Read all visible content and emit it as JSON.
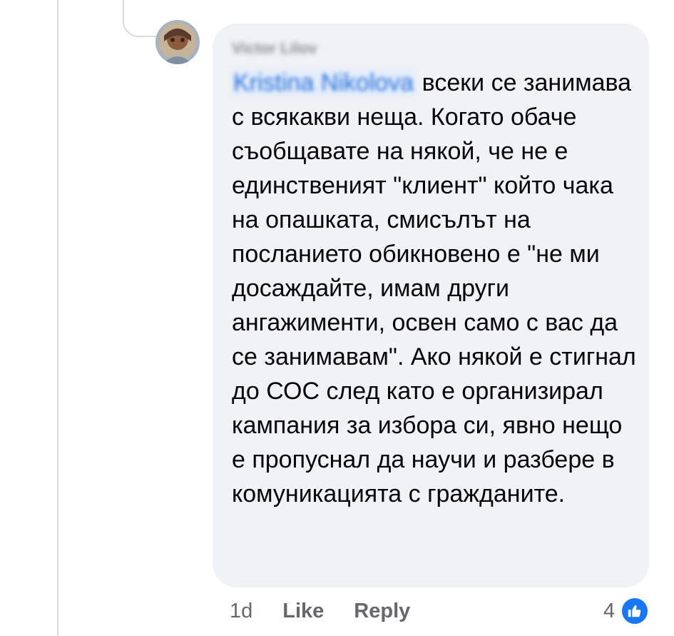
{
  "comment": {
    "author": "Victor Lilov",
    "mention": "Kristina Nikolova",
    "text": " всеки се занимава с всякакви неща. Когато обаче съобщавате на някой, че не е единственият \"клиент\" който чака на опашката, смисълът на посланието обикновено е \"не ми досаждайте, имам други ангажименти, освен само с вас да се занимавам\". Ако някой е стигнал до СОС след като е организирал кампания за избора си, явно нещо е пропуснал да научи и разбере в комуникацията с гражданите.",
    "timestamp": "1d",
    "like_label": "Like",
    "reply_label": "Reply",
    "reaction_count": "4",
    "reaction_icon": "thumbs-up-icon"
  },
  "colors": {
    "bubble": "#f0f2f5",
    "text": "#050505",
    "meta": "#65676b",
    "like_blue": "#1877f2"
  }
}
